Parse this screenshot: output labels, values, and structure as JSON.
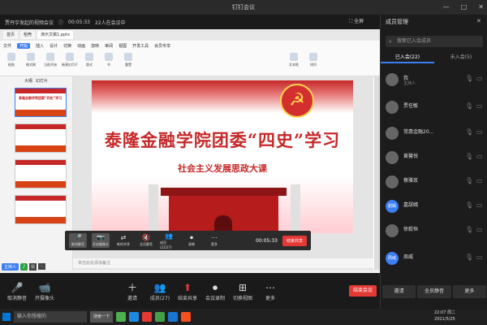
{
  "titlebar": {
    "title": "钉钉会议",
    "min": "—",
    "max": "□",
    "close": "✕"
  },
  "meeting": {
    "name": "贾丹宇发起的视频会议",
    "elapsed": "00:05:33",
    "count": "22人在会议中",
    "fullscreen": "全屏"
  },
  "wps": {
    "tabs": [
      "首页",
      "稻壳",
      "演示文稿1.pptx"
    ],
    "menu": [
      "文件",
      "开始",
      "插入",
      "设计",
      "切换",
      "动画",
      "放映",
      "审阅",
      "视图",
      "开发工具",
      "会员专享"
    ],
    "active_menu": "开始",
    "ribbon": [
      "粘贴",
      "格式刷",
      "当前开始",
      "新建幻灯片",
      "版式",
      "节",
      "重置",
      "文本框",
      "排列"
    ],
    "thumb_tabs": [
      "大纲",
      "幻灯片"
    ],
    "thumbs": [
      {
        "num": "1",
        "title": "泰隆金融学院团委“四史”学习"
      },
      {
        "num": "2",
        "title": ""
      },
      {
        "num": "3",
        "title": ""
      },
      {
        "num": "4",
        "title": ""
      }
    ],
    "notes": "单击此处添加备注",
    "zoom": "67%"
  },
  "slide": {
    "title": "泰隆金融学院团委“四史”学习",
    "subtitle": "社会主义发展思政大课"
  },
  "controls": {
    "buttons": [
      {
        "icon": "🎤",
        "label": "取消静音"
      },
      {
        "icon": "📷",
        "label": "开启摄像头"
      },
      {
        "icon": "⇄",
        "label": "新的共享"
      },
      {
        "icon": "🔇",
        "label": "全员静音"
      },
      {
        "icon": "👥",
        "label": "成员(22/27)"
      },
      {
        "icon": "⏺",
        "label": "录制"
      },
      {
        "icon": "⋯",
        "label": "更多"
      }
    ],
    "time": "00:05:33",
    "end_share": "结束共享"
  },
  "host": {
    "label": "主持人",
    "me": "我"
  },
  "toolbar": {
    "items": [
      {
        "icon": "🎤",
        "label": "取消静音"
      },
      {
        "icon": "📹",
        "label": "开摄像头"
      },
      {
        "icon": "＋",
        "label": "邀请"
      },
      {
        "icon": "👥",
        "label": "成员(27)"
      },
      {
        "icon": "⬆",
        "label": "结束共享"
      },
      {
        "icon": "⏺",
        "label": "会议录制"
      },
      {
        "icon": "⊞",
        "label": "切换视图"
      },
      {
        "icon": "⋯",
        "label": "更多"
      }
    ],
    "end_meeting": "结束会议"
  },
  "panel": {
    "title": "成员管理",
    "search_placeholder": "搜索已入会成员",
    "tabs": [
      "已入会(22)",
      "未入会(5)"
    ],
    "members": [
      {
        "avatar": "",
        "name": "我",
        "role": "主持人"
      },
      {
        "avatar": "",
        "name": "贾任敏",
        "role": ""
      },
      {
        "avatar": "",
        "name": "常惠金融20...",
        "role": ""
      },
      {
        "avatar": "",
        "name": "黄馨悦",
        "role": ""
      },
      {
        "avatar": "",
        "name": "蔡雅玫",
        "role": ""
      },
      {
        "avatar": "甜嫣",
        "name": "嘉甜嫣",
        "role": ""
      },
      {
        "avatar": "",
        "name": "徐毅恒",
        "role": ""
      },
      {
        "avatar": "周威",
        "name": "周威",
        "role": ""
      }
    ],
    "footer": [
      "邀请",
      "全员静音",
      "更多"
    ]
  },
  "taskbar": {
    "search": "输入你想搜的",
    "search_btn": "搜索一下",
    "time": "22:07 周二",
    "date": "2021/5/25"
  }
}
